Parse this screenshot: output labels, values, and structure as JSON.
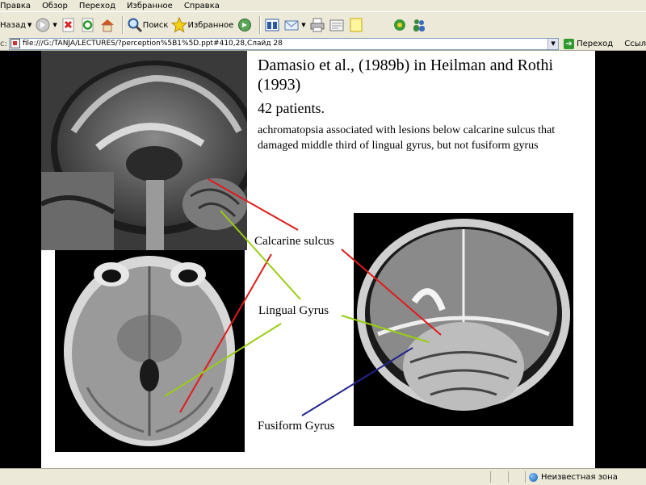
{
  "menu": [
    "Правка",
    "Обзор",
    "Переход",
    "Избранное",
    "Справка"
  ],
  "toolbar": {
    "back_label": "Назад",
    "search_label": "Поиск",
    "favorites_label": "Избранное"
  },
  "address": {
    "label": "с:",
    "value": "file:///G:/TANJA/LECTURES/?perception%5B1%5D.ppt#410,28,Слайд 28",
    "go_label": "Переход",
    "links_label": "Ссыл"
  },
  "slide": {
    "title": "Damasio et al., (1989b) in Heilman and Rothi (1993)",
    "count": "42 patients.",
    "description": "achromatopsia  associated with lesions below calcarine sulcus that damaged middle third of lingual gyrus, but not fusiform gyrus",
    "labels": {
      "calcarine": "Calcarine sulcus",
      "lingual": "Lingual Gyrus",
      "fusiform": "Fusiform Gyrus"
    },
    "colors": {
      "calcarine": "#e01b1b",
      "lingual": "#9acd12",
      "fusiform": "#23238f"
    }
  },
  "status": {
    "zone": "Неизвестная зона"
  }
}
